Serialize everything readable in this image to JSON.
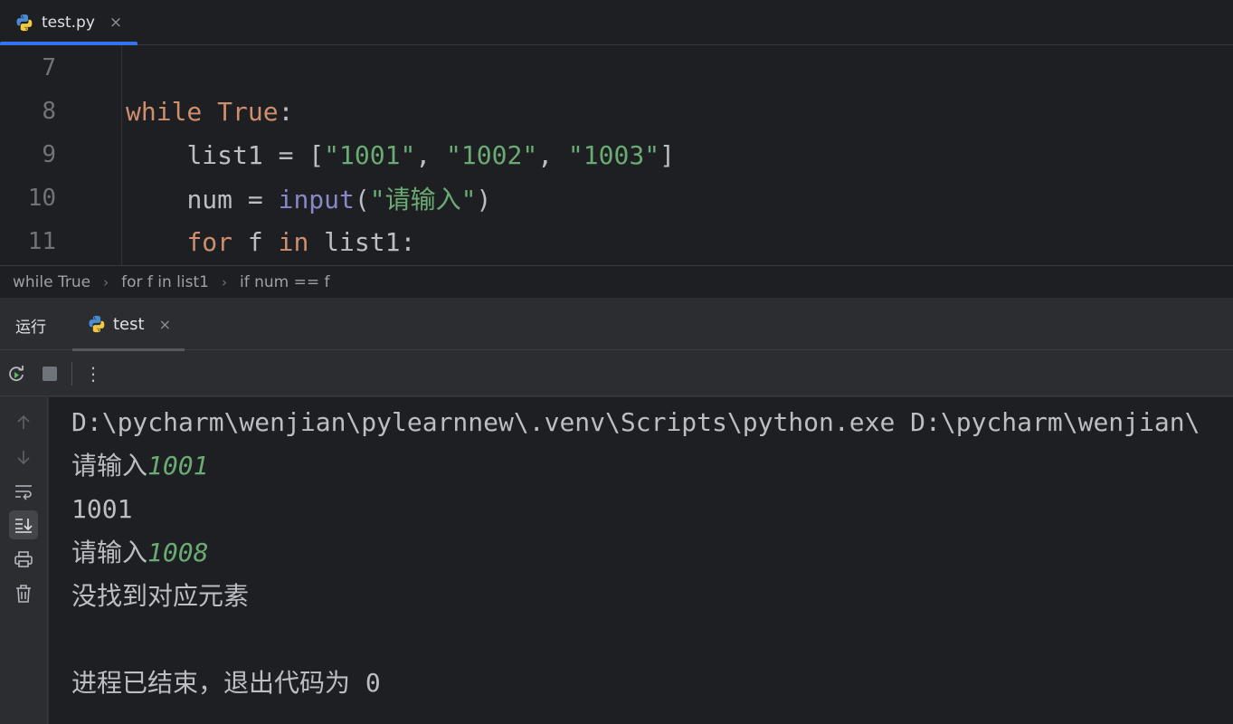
{
  "editor_tab": {
    "filename": "test.py",
    "close": "×"
  },
  "code": {
    "lines": [
      {
        "num": "7"
      },
      {
        "num": "8",
        "kw1": "while",
        "kw2": "True",
        "rest": ":"
      },
      {
        "num": "9",
        "indent": "    ",
        "var": "list1 = [",
        "s1": "\"1001\"",
        "c1": ", ",
        "s2": "\"1002\"",
        "c2": ", ",
        "s3": "\"1003\"",
        "end": "]"
      },
      {
        "num": "10",
        "indent": "    ",
        "var": "num = ",
        "fn": "input",
        "open": "(",
        "s": "\"请输入\"",
        "close": ")"
      },
      {
        "num": "11",
        "indent": "    ",
        "kw1": "for",
        "mid": " f ",
        "kw2": "in",
        "rest": " list1:"
      }
    ]
  },
  "breadcrumb": {
    "items": [
      "while True",
      "for f in list1",
      "if num == f"
    ],
    "separator": "›"
  },
  "run": {
    "title": "运行",
    "tab_name": "test",
    "close": "×",
    "more": "⋮"
  },
  "console": {
    "line1": "D:\\pycharm\\wenjian\\pylearnnew\\.venv\\Scripts\\python.exe D:\\pycharm\\wenjian\\",
    "prompt1": "请输入",
    "input1": "1001",
    "output1": "1001",
    "prompt2": "请输入",
    "input2": "1008",
    "output2": "没找到对应元素",
    "exit": "进程已结束，退出代码为 0"
  },
  "colors": {
    "accent": "#3574f0",
    "keyword": "#cf8e6d",
    "string": "#6aab73",
    "builtin": "#8888c6"
  }
}
